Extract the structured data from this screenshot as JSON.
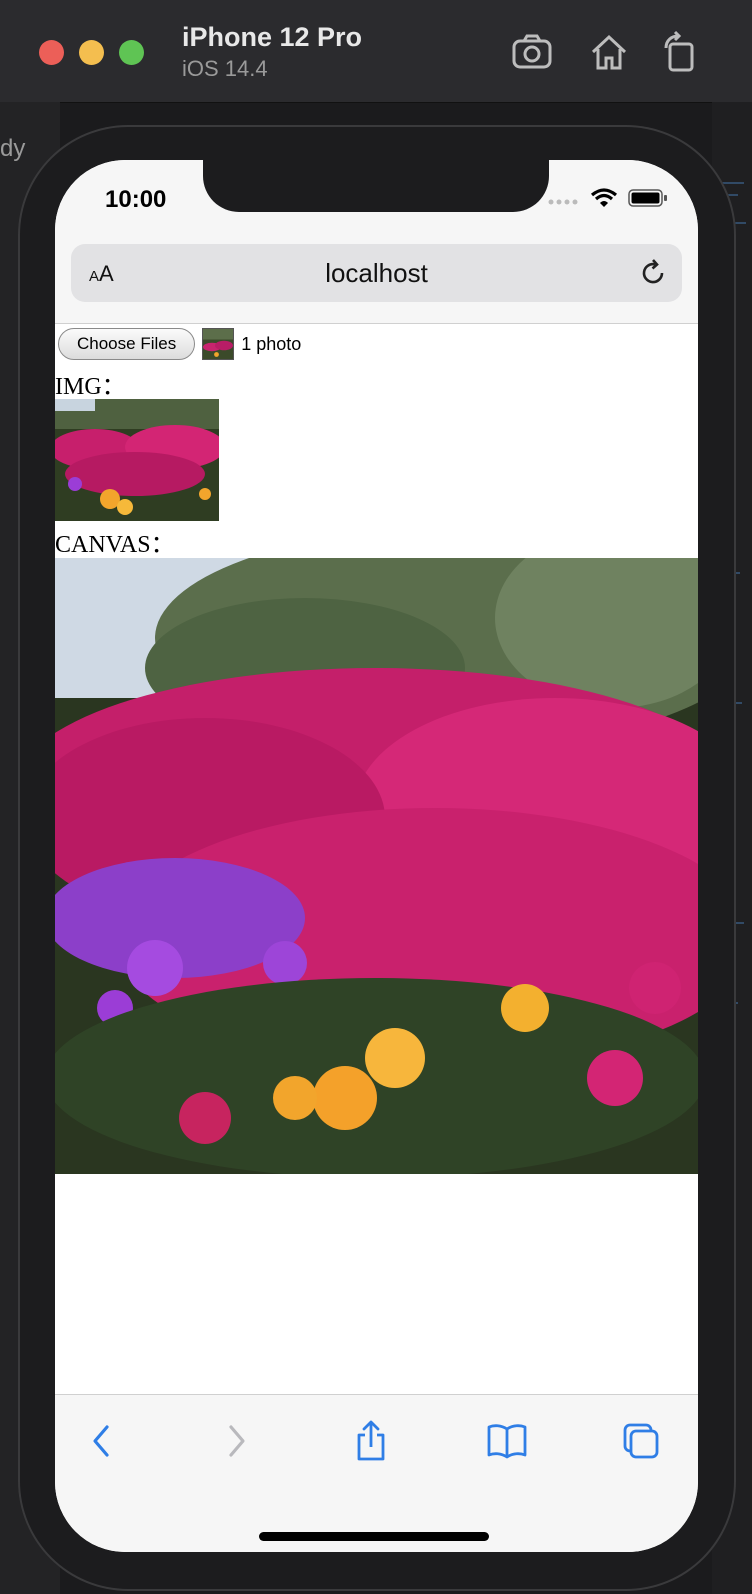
{
  "simulator": {
    "device_name": "iPhone 12 Pro",
    "os_version": "iOS 14.4",
    "breadcrumb": "dy"
  },
  "status_bar": {
    "time": "10:00"
  },
  "safari": {
    "text_size_label_small": "A",
    "text_size_label_large": "A",
    "url": "localhost"
  },
  "page": {
    "file_input": {
      "button_label": "Choose Files",
      "selection_text": "1 photo"
    },
    "img_label": "IMG：",
    "canvas_label": "CANVAS："
  },
  "colors": {
    "accent": "#2f7ee6",
    "disabled": "#b9b9bd",
    "close": "#ec5f58",
    "minimize": "#f4be4f",
    "maximize": "#5fc454"
  },
  "icons": {
    "screenshot": "camera-icon",
    "home": "home-icon",
    "rotate": "rotate-icon",
    "reload": "reload-icon",
    "back": "chevron-left-icon",
    "forward": "chevron-right-icon",
    "share": "share-icon",
    "bookmarks": "book-icon",
    "tabs": "tabs-icon"
  }
}
